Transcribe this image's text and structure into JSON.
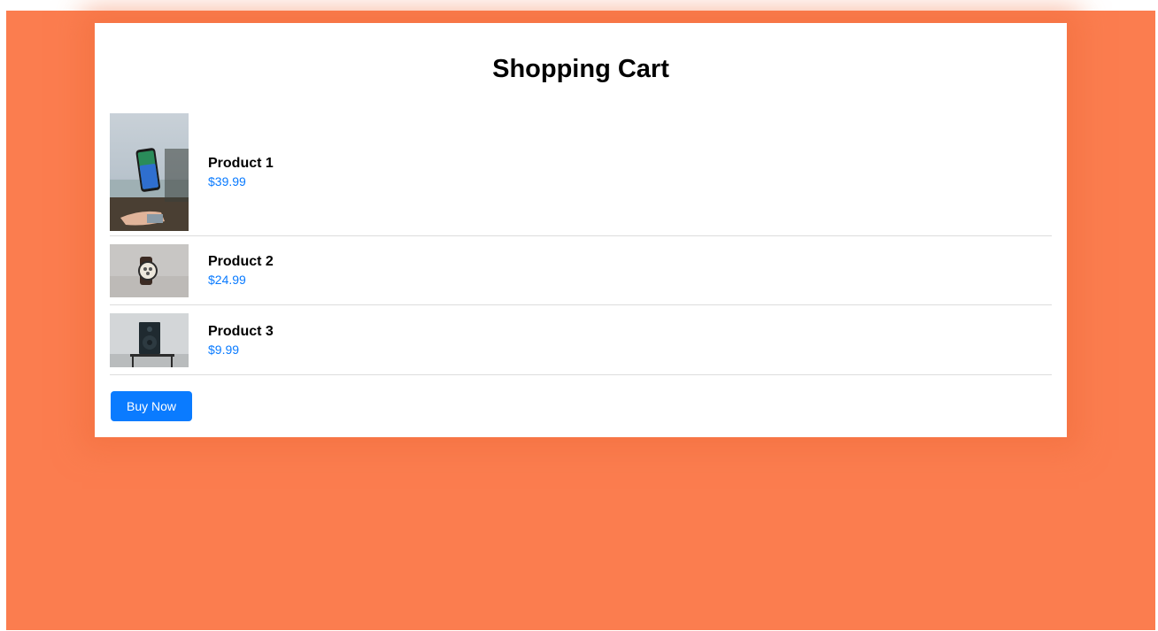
{
  "cart": {
    "title": "Shopping Cart",
    "items": [
      {
        "name": "Product 1",
        "price": "$39.99",
        "image_icon": "phone-photo-icon"
      },
      {
        "name": "Product 2",
        "price": "$24.99",
        "image_icon": "watch-photo-icon"
      },
      {
        "name": "Product 3",
        "price": "$9.99",
        "image_icon": "speaker-photo-icon"
      }
    ],
    "buy_label": "Buy Now"
  },
  "colors": {
    "background": "#fb7d4f",
    "accent": "#0a7bff",
    "card": "#ffffff"
  }
}
